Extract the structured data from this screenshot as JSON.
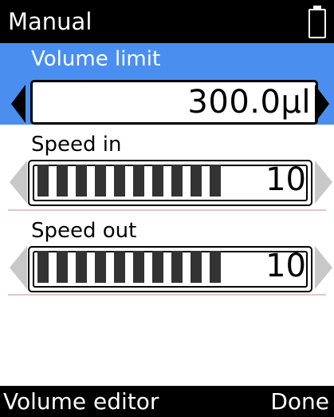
{
  "header": {
    "title": "Manual",
    "battery_icon": "battery-icon"
  },
  "settings": {
    "volume_limit": {
      "label": "Volume limit",
      "value": "300.0µl"
    },
    "speed_in": {
      "label": "Speed in",
      "value": "10",
      "level": 10,
      "max": 10
    },
    "speed_out": {
      "label": "Speed out",
      "value": "10",
      "level": 10,
      "max": 10
    }
  },
  "footer": {
    "left_softkey": "Volume editor",
    "right_softkey": "Done"
  },
  "colors": {
    "selection": "#4a8ff0",
    "bars": "#333333",
    "divider": "#e3c6c6",
    "arrow_inactive": "#c8c8c8"
  }
}
